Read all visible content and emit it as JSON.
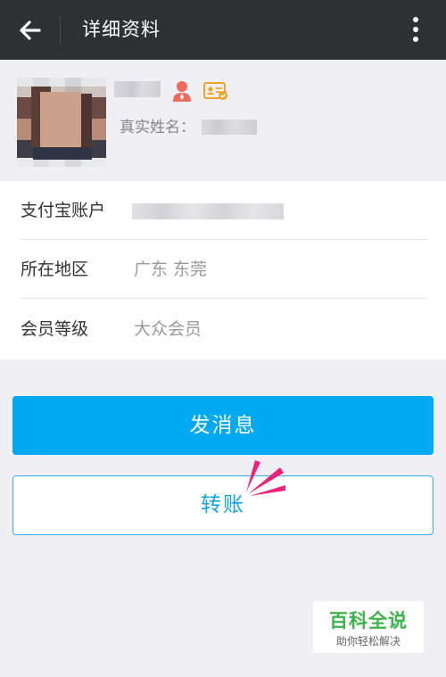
{
  "header": {
    "title": "详细资料",
    "back_icon": "arrow-left-icon",
    "more_icon": "more-vertical-icon",
    "background": "#2e3134"
  },
  "profile": {
    "avatar_icon": "avatar-photo",
    "badges": [
      "user-icon",
      "id-card-verified-icon"
    ],
    "real_name_label": "真实姓名："
  },
  "info_rows": [
    {
      "label": "支付宝账户",
      "value": ""
    },
    {
      "label": "所在地区",
      "value": "广东 东莞"
    },
    {
      "label": "会员等级",
      "value": "大众会员"
    }
  ],
  "actions": {
    "message_label": "发消息",
    "transfer_label": "转账",
    "accent": "#00a9f1"
  },
  "watermark": {
    "title": "百科全说",
    "subtitle": "助你轻松解决",
    "color": "#3bb54a"
  }
}
